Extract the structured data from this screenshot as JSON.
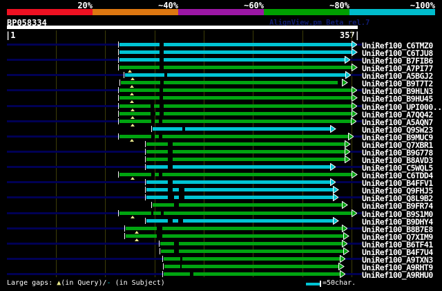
{
  "header": {
    "title": "BP058334",
    "watermark": "AlignView.pm Beta rel.7",
    "scale": {
      "labels": [
        "20%",
        "~40%",
        "~60%",
        "~80%",
        "~100%"
      ],
      "colors": [
        "#ee1122",
        "#dd7711",
        "#9c17a5",
        "#00a000",
        "#00bccc"
      ]
    },
    "ruler": {
      "start_label": "|1",
      "end_label": "357|"
    }
  },
  "colors": {
    "bar_cyan": "#00c4d4",
    "bar_green": "#00a410",
    "leader_navy": "#000054",
    "gridline": "#3d3d08",
    "gap_marker_yellow": "#eaea8c",
    "watermark_navy": "#111c70",
    "text_white": "#ffffff"
  },
  "query": {
    "id": "BP058334",
    "start": 1,
    "end": 357
  },
  "rows": [
    {
      "label": "UniRef100_C6TMZ0",
      "color": "cyan",
      "start": 173,
      "end": 517,
      "gaps": [
        [
          231,
          237
        ]
      ],
      "tris": []
    },
    {
      "label": "UniRef100_C6TJU8",
      "color": "cyan",
      "start": 173,
      "end": 517,
      "gaps": [
        [
          231,
          237
        ]
      ],
      "tris": []
    },
    {
      "label": "UniRef100_B7FIB6",
      "color": "cyan",
      "start": 173,
      "end": 507,
      "gaps": [
        [
          231,
          237
        ]
      ],
      "tris": []
    },
    {
      "label": "UniRef100_A7PI77",
      "color": "green",
      "start": 173,
      "end": 517,
      "gaps": [
        [
          231,
          237
        ]
      ],
      "tris": [
        188
      ]
    },
    {
      "label": "UniRef100_A5BGJ2",
      "color": "cyan",
      "start": 181,
      "end": 508,
      "gaps": [
        [
          238,
          242
        ]
      ],
      "tris": [
        192
      ]
    },
    {
      "label": "UniRef100_B9T7T2",
      "color": "green",
      "start": 175,
      "end": 503,
      "gaps": [
        [
          232,
          237
        ],
        [
          489,
          495
        ]
      ],
      "tris": [
        191
      ]
    },
    {
      "label": "UniRef100_B9HLN3",
      "color": "green",
      "start": 173,
      "end": 517,
      "gaps": [
        [
          231,
          236
        ]
      ],
      "tris": [
        191
      ]
    },
    {
      "label": "UniRef100_B9HU45",
      "color": "green",
      "start": 173,
      "end": 517,
      "gaps": [
        [
          231,
          236
        ]
      ],
      "tris": [
        191
      ]
    },
    {
      "label": "UniRef100_UPI000..",
      "color": "green",
      "start": 173,
      "end": 517,
      "gaps": [
        [
          218,
          223
        ],
        [
          231,
          237
        ]
      ],
      "tris": [
        192
      ]
    },
    {
      "label": "UniRef100_A7QQ42",
      "color": "green",
      "start": 173,
      "end": 517,
      "gaps": [
        [
          218,
          225
        ],
        [
          231,
          237
        ]
      ],
      "tris": [
        192
      ]
    },
    {
      "label": "UniRef100_A5AQN7",
      "color": "green",
      "start": 173,
      "end": 516,
      "gaps": [
        [
          219,
          224
        ],
        [
          230,
          235
        ]
      ],
      "tris": [
        192
      ]
    },
    {
      "label": "UniRef100_Q9SW23",
      "color": "cyan",
      "start": 221,
      "end": 486,
      "gaps": [
        [
          264,
          268
        ]
      ],
      "tris": []
    },
    {
      "label": "UniRef100_B9MUC9",
      "color": "green",
      "start": 173,
      "end": 512,
      "gaps": [
        [
          219,
          224
        ],
        [
          230,
          235
        ]
      ],
      "tris": [
        191
      ]
    },
    {
      "label": "UniRef100_Q7XBR1",
      "color": "green",
      "start": 212,
      "end": 507,
      "gaps": [
        [
          243,
          250
        ]
      ],
      "tris": []
    },
    {
      "label": "UniRef100_B9G778",
      "color": "green",
      "start": 212,
      "end": 507,
      "gaps": [
        [
          243,
          250
        ]
      ],
      "tris": []
    },
    {
      "label": "UniRef100_B8AVD3",
      "color": "green",
      "start": 212,
      "end": 507,
      "gaps": [
        [
          243,
          250
        ]
      ],
      "tris": []
    },
    {
      "label": "UniRef100_C5WQL5",
      "color": "cyan",
      "start": 212,
      "end": 486,
      "gaps": [
        [
          243,
          250
        ]
      ],
      "tris": []
    },
    {
      "label": "UniRef100_C6TDD4",
      "color": "green",
      "start": 173,
      "end": 517,
      "gaps": [
        [
          219,
          224
        ],
        [
          230,
          235
        ]
      ],
      "tris": [
        192
      ]
    },
    {
      "label": "UniRef100_B4FFV1",
      "color": "cyan",
      "start": 212,
      "end": 486,
      "gaps": [
        [
          243,
          250
        ]
      ],
      "tris": []
    },
    {
      "label": "UniRef100_Q9FHJ5",
      "color": "cyan",
      "start": 212,
      "end": 490,
      "gaps": [
        [
          243,
          250
        ],
        [
          259,
          267
        ]
      ],
      "tris": []
    },
    {
      "label": "UniRef100_Q8L9B2",
      "color": "cyan",
      "start": 212,
      "end": 490,
      "gaps": [
        [
          243,
          252
        ],
        [
          259,
          267
        ]
      ],
      "tris": []
    },
    {
      "label": "UniRef100_B9FR74",
      "color": "green",
      "start": 221,
      "end": 503,
      "gaps": [
        [
          252,
          259
        ]
      ],
      "tris": []
    },
    {
      "label": "UniRef100_B9S1M0",
      "color": "green",
      "start": 173,
      "end": 517,
      "gaps": [
        [
          219,
          222
        ],
        [
          233,
          237
        ]
      ],
      "tris": [
        192
      ]
    },
    {
      "label": "UniRef100_B9DHY4",
      "color": "cyan",
      "start": 212,
      "end": 490,
      "gaps": [
        [
          243,
          250
        ],
        [
          258,
          265
        ]
      ],
      "tris": []
    },
    {
      "label": "UniRef100_B8B7E8",
      "color": "green",
      "start": 182,
      "end": 503,
      "gaps": [
        [
          227,
          235
        ]
      ],
      "tris": [
        198
      ]
    },
    {
      "label": "UniRef100_Q7XIM9",
      "color": "green",
      "start": 182,
      "end": 505,
      "gaps": [
        [
          227,
          235
        ]
      ],
      "tris": [
        198
      ]
    },
    {
      "label": "UniRef100_B6TF41",
      "color": "green",
      "start": 232,
      "end": 503,
      "gaps": [
        [
          252,
          259
        ]
      ],
      "tris": []
    },
    {
      "label": "UniRef100_B4F7U4",
      "color": "green",
      "start": 233,
      "end": 505,
      "gaps": [
        [
          252,
          259
        ]
      ],
      "tris": []
    },
    {
      "label": "UniRef100_A9TXN3",
      "color": "green",
      "start": 237,
      "end": 500,
      "gaps": [
        [
          261,
          264
        ]
      ],
      "tris": []
    },
    {
      "label": "UniRef100_A9RHT9",
      "color": "green",
      "start": 238,
      "end": 498,
      "gaps": [
        [
          261,
          263
        ]
      ],
      "tris": []
    },
    {
      "label": "UniRef100_A9RHU0",
      "color": "green",
      "start": 237,
      "end": 500,
      "gaps": [
        [
          275,
          280
        ]
      ],
      "tris": []
    }
  ],
  "footer": {
    "gaps_prefix": "Large gaps: ",
    "gaps_tri": "▲",
    "gaps_mid": "(in Query)/",
    "gaps_dash": "-",
    "gaps_suffix": " (in Subject)",
    "scalebar_label": "=50char."
  }
}
